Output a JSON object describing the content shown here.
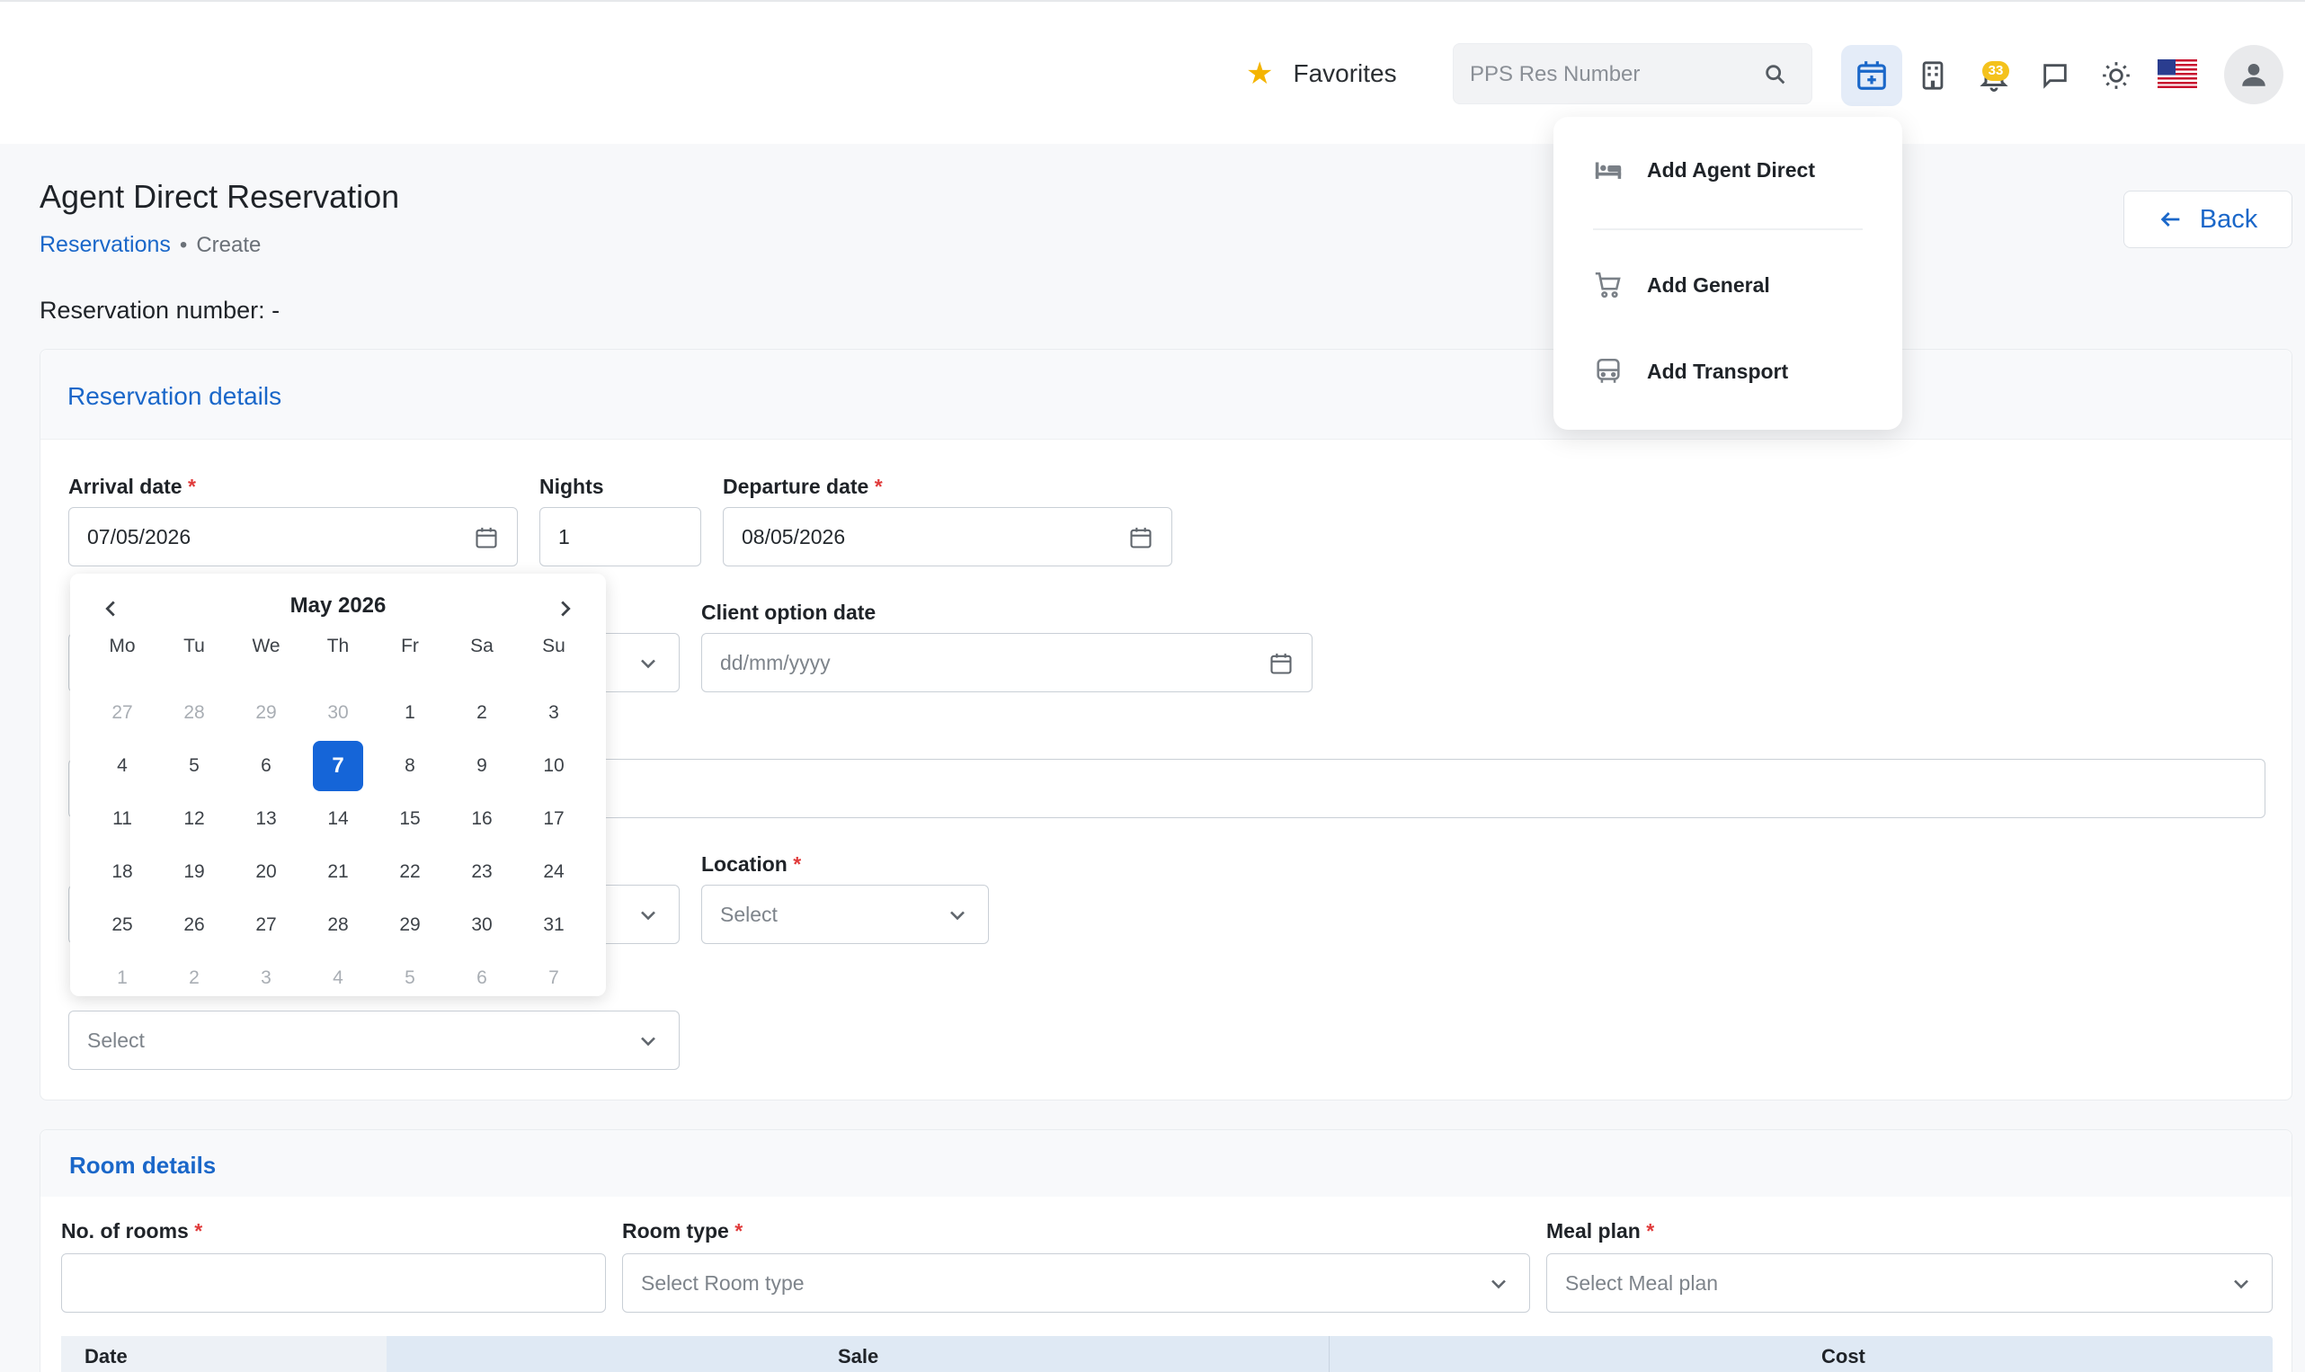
{
  "topbar": {
    "favorites_label": "Favorites",
    "search_placeholder": "PPS Res Number",
    "notification_count": "33"
  },
  "header": {
    "title": "Agent Direct Reservation",
    "breadcrumb_link": "Reservations",
    "breadcrumb_sep": "•",
    "breadcrumb_current": "Create",
    "reservation_number": "Reservation number: -",
    "back_label": "Back"
  },
  "menu": {
    "items": [
      {
        "label": "Add Agent Direct",
        "icon": "bed-icon"
      },
      {
        "label": "Add General",
        "icon": "cart-icon"
      },
      {
        "label": "Add Transport",
        "icon": "bus-icon"
      }
    ]
  },
  "reservation_details": {
    "title": "Reservation details",
    "arrival_label": "Arrival date",
    "arrival_value": "07/05/2026",
    "nights_label": "Nights",
    "nights_value": "1",
    "departure_label": "Departure date",
    "departure_value": "08/05/2026",
    "client_option_label": "Client option date",
    "client_option_placeholder": "dd/mm/yyyy",
    "location_label": "Location",
    "location_value": "Select",
    "supplier_value": "Select",
    "required_mark": "*"
  },
  "calendar": {
    "month_label": "May 2026",
    "weekdays": [
      "Mo",
      "Tu",
      "We",
      "Th",
      "Fr",
      "Sa",
      "Su"
    ],
    "weeks": [
      [
        {
          "d": "27",
          "m": true
        },
        {
          "d": "28",
          "m": true
        },
        {
          "d": "29",
          "m": true
        },
        {
          "d": "30",
          "m": true
        },
        {
          "d": "1"
        },
        {
          "d": "2"
        },
        {
          "d": "3"
        }
      ],
      [
        {
          "d": "4"
        },
        {
          "d": "5"
        },
        {
          "d": "6"
        },
        {
          "d": "7",
          "sel": true
        },
        {
          "d": "8"
        },
        {
          "d": "9"
        },
        {
          "d": "10"
        }
      ],
      [
        {
          "d": "11"
        },
        {
          "d": "12"
        },
        {
          "d": "13"
        },
        {
          "d": "14"
        },
        {
          "d": "15"
        },
        {
          "d": "16"
        },
        {
          "d": "17"
        }
      ],
      [
        {
          "d": "18"
        },
        {
          "d": "19"
        },
        {
          "d": "20"
        },
        {
          "d": "21"
        },
        {
          "d": "22"
        },
        {
          "d": "23"
        },
        {
          "d": "24"
        }
      ],
      [
        {
          "d": "25"
        },
        {
          "d": "26"
        },
        {
          "d": "27"
        },
        {
          "d": "28"
        },
        {
          "d": "29"
        },
        {
          "d": "30"
        },
        {
          "d": "31"
        }
      ],
      [
        {
          "d": "1",
          "m": true
        },
        {
          "d": "2",
          "m": true
        },
        {
          "d": "3",
          "m": true
        },
        {
          "d": "4",
          "m": true
        },
        {
          "d": "5",
          "m": true
        },
        {
          "d": "6",
          "m": true
        },
        {
          "d": "7",
          "m": true
        }
      ]
    ]
  },
  "room_details": {
    "title": "Room details",
    "rooms_label": "No. of rooms",
    "room_type_label": "Room type",
    "room_type_placeholder": "Select Room type",
    "meal_plan_label": "Meal plan",
    "meal_plan_placeholder": "Select Meal plan",
    "table_headers": [
      "Date",
      "Sale",
      "Cost"
    ]
  },
  "colors": {
    "accent": "#1a67c9",
    "selected_day": "#1565d8",
    "badge": "#f4c21c",
    "required": "#e03b3b"
  }
}
